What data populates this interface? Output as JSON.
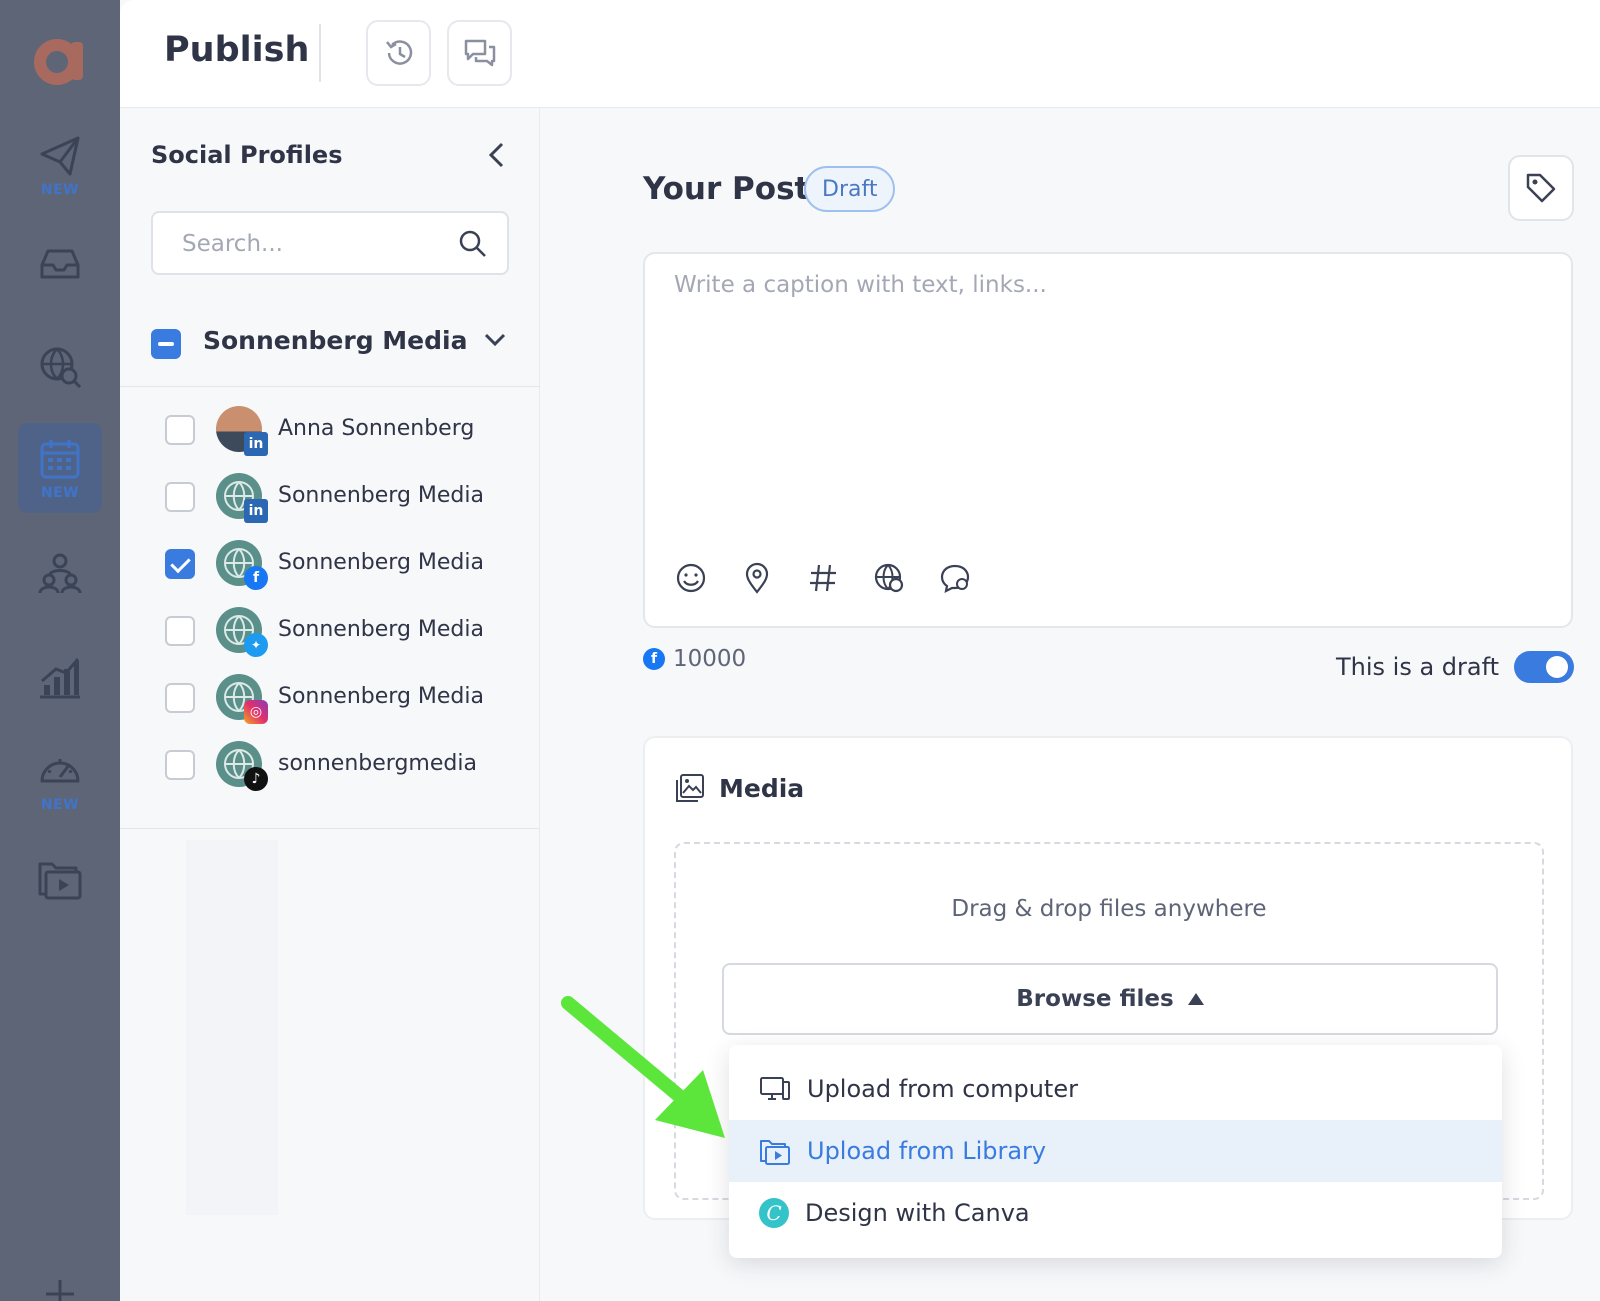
{
  "app": {
    "title": "Publish",
    "brand_color": "#3a7be0"
  },
  "rail": {
    "items": [
      {
        "icon": "paper-plane-icon",
        "tag": "NEW"
      },
      {
        "icon": "inbox-icon",
        "tag": ""
      },
      {
        "icon": "globe-search-icon",
        "tag": ""
      },
      {
        "icon": "calendar-icon",
        "tag": "NEW"
      },
      {
        "icon": "people-icon",
        "tag": ""
      },
      {
        "icon": "analytics-icon",
        "tag": ""
      },
      {
        "icon": "gauge-icon",
        "tag": "NEW"
      },
      {
        "icon": "media-library-icon",
        "tag": ""
      }
    ]
  },
  "profiles": {
    "title": "Social Profiles",
    "search_placeholder": "Search...",
    "group": {
      "name": "Sonnenberg Media",
      "state": "partial"
    },
    "items": [
      {
        "name": "Anna Sonnenberg",
        "network": "linkedin",
        "checked": false
      },
      {
        "name": "Sonnenberg Media",
        "network": "linkedin",
        "checked": false
      },
      {
        "name": "Sonnenberg Media",
        "network": "facebook",
        "checked": true
      },
      {
        "name": "Sonnenberg Media",
        "network": "twitter",
        "checked": false
      },
      {
        "name": "Sonnenberg Media",
        "network": "instagram",
        "checked": false
      },
      {
        "name": "sonnenbergmedia",
        "network": "tiktok",
        "checked": false
      }
    ]
  },
  "post": {
    "title": "Your Post",
    "status": "Draft",
    "caption_placeholder": "Write a caption with text, links...",
    "char_count": "10000",
    "draft_toggle_label": "This is a draft",
    "draft_toggle_on": true
  },
  "media": {
    "title": "Media",
    "drop_text": "Drag & drop files anywhere",
    "browse_label": "Browse files",
    "menu": [
      {
        "label": "Upload from computer",
        "icon": "monitor-icon",
        "highlighted": false
      },
      {
        "label": "Upload from Library",
        "icon": "media-library-icon",
        "highlighted": true
      },
      {
        "label": "Design with Canva",
        "icon": "canva-icon",
        "highlighted": false
      }
    ]
  },
  "annotation": {
    "type": "arrow",
    "color": "#5ce63c"
  }
}
